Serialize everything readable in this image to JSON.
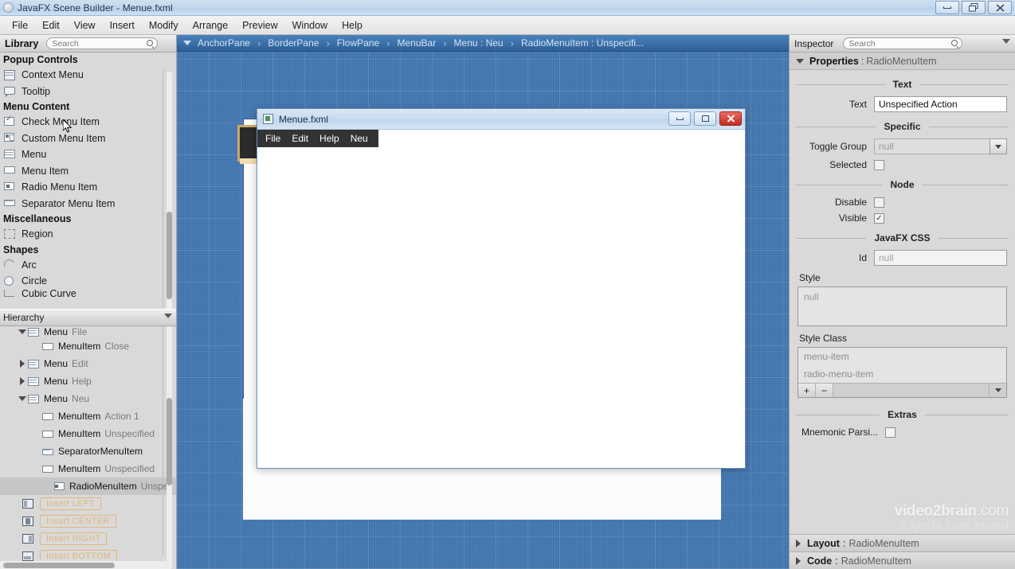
{
  "window": {
    "title": "JavaFX Scene Builder - Menue.fxml",
    "icon": "app-icon",
    "buttons": [
      {
        "name": "minimize",
        "glyph": "minimize-icon"
      },
      {
        "name": "restore",
        "glyph": "restore-icon"
      },
      {
        "name": "close",
        "glyph": "close-icon"
      }
    ]
  },
  "menubar": {
    "items": [
      "File",
      "Edit",
      "View",
      "Insert",
      "Modify",
      "Arrange",
      "Preview",
      "Window",
      "Help"
    ]
  },
  "library": {
    "title": "Library",
    "search_placeholder": "Search",
    "groups": [
      {
        "label": "Popup Controls",
        "items": [
          {
            "label": "Context Menu",
            "icon": "context-menu-icon"
          },
          {
            "label": "Tooltip",
            "icon": "tooltip-icon"
          }
        ]
      },
      {
        "label": "Menu Content",
        "items": [
          {
            "label": "Check Menu Item",
            "icon": "check-menu-item-icon"
          },
          {
            "label": "Custom Menu Item",
            "icon": "custom-menu-item-icon"
          },
          {
            "label": "Menu",
            "icon": "menu-icon"
          },
          {
            "label": "Menu Item",
            "icon": "menu-item-icon"
          },
          {
            "label": "Radio Menu Item",
            "icon": "radio-menu-item-icon"
          },
          {
            "label": "Separator Menu Item",
            "icon": "separator-menu-item-icon"
          }
        ]
      },
      {
        "label": "Miscellaneous",
        "items": [
          {
            "label": "Region",
            "icon": "region-icon"
          }
        ]
      },
      {
        "label": "Shapes",
        "items": [
          {
            "label": "Arc",
            "icon": "arc-icon"
          },
          {
            "label": "Circle",
            "icon": "circle-icon"
          },
          {
            "label": "Cubic Curve",
            "icon": "cubic-curve-icon"
          }
        ]
      }
    ]
  },
  "hierarchy": {
    "title": "Hierarchy",
    "rows": [
      {
        "twisty": "down",
        "indent": 1,
        "type": "Menu",
        "value": "File",
        "icon": "menu-icon",
        "selected": false
      },
      {
        "twisty": "none",
        "indent": 2,
        "type": "MenuItem",
        "value": "Close",
        "icon": "menu-item-icon",
        "selected": false
      },
      {
        "twisty": "right",
        "indent": 1,
        "type": "Menu",
        "value": "Edit",
        "icon": "menu-icon",
        "selected": false
      },
      {
        "twisty": "right",
        "indent": 1,
        "type": "Menu",
        "value": "Help",
        "icon": "menu-icon",
        "selected": false
      },
      {
        "twisty": "down",
        "indent": 1,
        "type": "Menu",
        "value": "Neu",
        "icon": "menu-icon",
        "selected": false
      },
      {
        "twisty": "none",
        "indent": 2,
        "type": "MenuItem",
        "value": "Action 1",
        "icon": "menu-item-icon",
        "selected": false
      },
      {
        "twisty": "none",
        "indent": 2,
        "type": "MenuItem",
        "value": "Unspecified",
        "icon": "menu-item-icon",
        "selected": false
      },
      {
        "twisty": "none",
        "indent": 2,
        "type": "SeparatorMenuItem",
        "value": "",
        "icon": "separator-menu-item-icon",
        "selected": false
      },
      {
        "twisty": "none",
        "indent": 2,
        "type": "MenuItem",
        "value": "Unspecified",
        "icon": "menu-item-icon",
        "selected": false
      },
      {
        "twisty": "none",
        "indent": 3,
        "type": "RadioMenuItem",
        "value": "Unspe",
        "icon": "radio-menu-item-icon",
        "selected": true
      }
    ],
    "drop_targets": [
      {
        "label": "Insert LEFT",
        "icon": "insert-left-icon"
      },
      {
        "label": "Insert CENTER",
        "icon": "insert-center-icon"
      },
      {
        "label": "Insert RIGHT",
        "icon": "insert-right-icon"
      },
      {
        "label": "Insert BOTTOM",
        "icon": "insert-bottom-icon"
      }
    ]
  },
  "breadcrumb": {
    "items": [
      "AnchorPane",
      "BorderPane",
      "FlowPane",
      "MenuBar",
      "Menu : Neu",
      "RadioMenuItem : Unspecifi..."
    ],
    "separator": "›"
  },
  "preview": {
    "title": "Menue.fxml",
    "icon": "fxml-window-icon",
    "menu_items": [
      "File",
      "Edit",
      "Help",
      "Neu"
    ],
    "buttons": [
      {
        "name": "minimize",
        "glyph": "minimize-icon"
      },
      {
        "name": "maximize",
        "glyph": "maximize-icon"
      },
      {
        "name": "close",
        "glyph": "x"
      }
    ]
  },
  "inspector": {
    "title": "Inspector",
    "search_placeholder": "Search",
    "properties_label": "Properties",
    "properties_sep": ":",
    "properties_class": "RadioMenuItem",
    "sections": {
      "text": {
        "title": "Text",
        "text_label": "Text",
        "text_value": "Unspecified Action"
      },
      "specific": {
        "title": "Specific",
        "toggle_group_label": "Toggle Group",
        "toggle_group_value": "null",
        "selected_label": "Selected",
        "selected_checked": false
      },
      "node": {
        "title": "Node",
        "disable_label": "Disable",
        "disable_checked": false,
        "visible_label": "Visible",
        "visible_checked": true,
        "visible_mark": "✓"
      },
      "css": {
        "title": "JavaFX CSS",
        "id_label": "Id",
        "id_value": "null",
        "style_label": "Style",
        "style_value": "null",
        "style_class_label": "Style Class",
        "style_classes": [
          "menu-item",
          "radio-menu-item"
        ],
        "add_btn": "+",
        "remove_btn": "−"
      },
      "extras": {
        "title": "Extras",
        "mnemonic_label": "Mnemonic Parsi...",
        "mnemonic_checked": false
      }
    },
    "accordion": [
      {
        "label": "Layout",
        "sep": ":",
        "cls": "RadioMenuItem"
      },
      {
        "label": "Code",
        "sep": ":",
        "cls": "RadioMenuItem"
      }
    ]
  },
  "watermark": {
    "line1_bold": "video2brain",
    "line1_light": ".com",
    "line2": "a lynda.com brand"
  },
  "colors": {
    "canvas_blue": "#3f73ad",
    "breadcrumb_blue": "#2f5f96",
    "panel_gray": "#d9d9d9",
    "accent_orange": "#e8a33d",
    "close_red": "#c62b20"
  }
}
